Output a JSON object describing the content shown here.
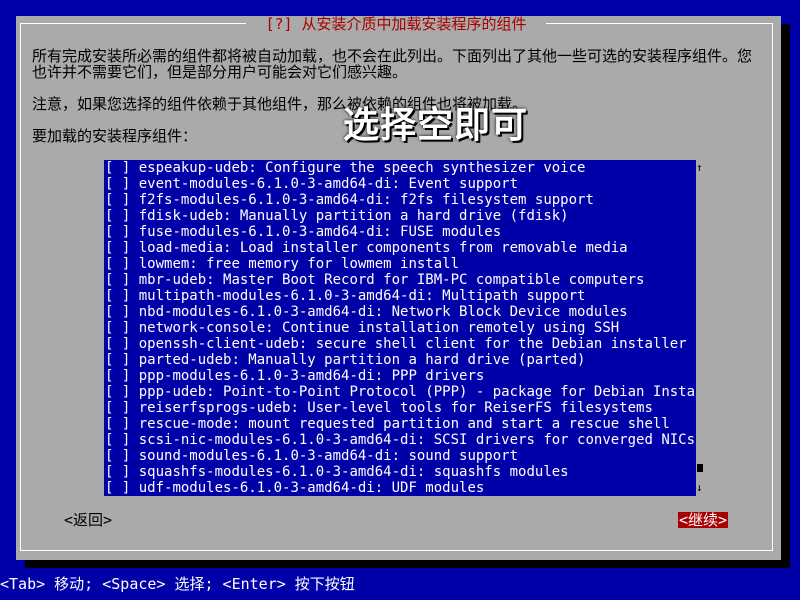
{
  "dialog": {
    "title": "[?] 从安装介质中加载安装程序的组件",
    "description": "所有完成安装所必需的组件都将被自动加载，也不会在此列出。下面列出了其他一些可选的安装程序组件。您也许并不需要它们，但是部分用户可能会对它们感兴趣。",
    "note": "注意，如果您选择的组件依赖于其他组件，那么被依赖的组件也将被加载。",
    "list_label": "要加载的安装程序组件："
  },
  "components": [
    {
      "checkbox": "[ ]",
      "label": "espeakup-udeb: Configure the speech synthesizer voice"
    },
    {
      "checkbox": "[ ]",
      "label": "event-modules-6.1.0-3-amd64-di: Event support"
    },
    {
      "checkbox": "[ ]",
      "label": "f2fs-modules-6.1.0-3-amd64-di: f2fs filesystem support"
    },
    {
      "checkbox": "[ ]",
      "label": "fdisk-udeb: Manually partition a hard drive (fdisk)"
    },
    {
      "checkbox": "[ ]",
      "label": "fuse-modules-6.1.0-3-amd64-di: FUSE modules"
    },
    {
      "checkbox": "[ ]",
      "label": "load-media: Load installer components from removable media"
    },
    {
      "checkbox": "[ ]",
      "label": "lowmem: free memory for lowmem install"
    },
    {
      "checkbox": "[ ]",
      "label": "mbr-udeb: Master Boot Record for IBM-PC compatible computers"
    },
    {
      "checkbox": "[ ]",
      "label": "multipath-modules-6.1.0-3-amd64-di: Multipath support"
    },
    {
      "checkbox": "[ ]",
      "label": "nbd-modules-6.1.0-3-amd64-di: Network Block Device modules"
    },
    {
      "checkbox": "[ ]",
      "label": "network-console: Continue installation remotely using SSH"
    },
    {
      "checkbox": "[ ]",
      "label": "openssh-client-udeb: secure shell client for the Debian installer"
    },
    {
      "checkbox": "[ ]",
      "label": "parted-udeb: Manually partition a hard drive (parted)"
    },
    {
      "checkbox": "[ ]",
      "label": "ppp-modules-6.1.0-3-amd64-di: PPP drivers"
    },
    {
      "checkbox": "[ ]",
      "label": "ppp-udeb: Point-to-Point Protocol (PPP) - package for Debian Installer"
    },
    {
      "checkbox": "[ ]",
      "label": "reiserfsprogs-udeb: User-level tools for ReiserFS filesystems"
    },
    {
      "checkbox": "[ ]",
      "label": "rescue-mode: mount requested partition and start a rescue shell"
    },
    {
      "checkbox": "[ ]",
      "label": "scsi-nic-modules-6.1.0-3-amd64-di: SCSI drivers for converged NICs"
    },
    {
      "checkbox": "[ ]",
      "label": "sound-modules-6.1.0-3-amd64-di: sound support"
    },
    {
      "checkbox": "[ ]",
      "label": "squashfs-modules-6.1.0-3-amd64-di: squashfs modules"
    },
    {
      "checkbox": "[ ]",
      "label": "udf-modules-6.1.0-3-amd64-di: UDF modules"
    }
  ],
  "scrollbar": {
    "up": "↑",
    "down": "↓"
  },
  "buttons": {
    "back": "<返回>",
    "continue": "<继续>"
  },
  "overlay_caption": "选择空即可",
  "statusbar": "<Tab> 移动; <Space> 选择; <Enter> 按下按钮",
  "colors": {
    "background": "#0000a8",
    "dialog": "#aaaaaa",
    "accent": "#a80000"
  }
}
